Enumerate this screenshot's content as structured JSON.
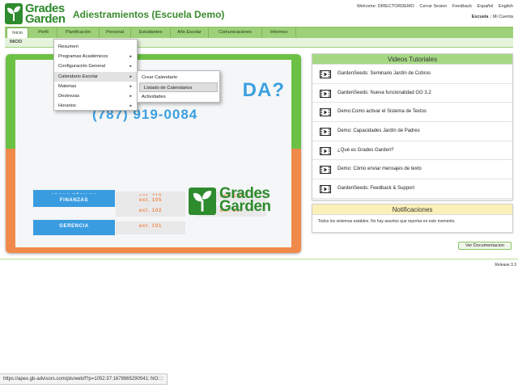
{
  "header": {
    "logo_line1": "Grades",
    "logo_line2": "Garden",
    "app_title": "Adiestramientos (Escuela Demo)",
    "top_links": {
      "welcome": "Welcome: DIRECTORDEMO",
      "logout": "Cerrar Sesion",
      "feedback": "Feedback",
      "spanish": "Español",
      "english": "English"
    },
    "user_links": {
      "school": "Escuela",
      "account": "Mi Cuenta",
      "separator": "|"
    }
  },
  "nav": {
    "tabs": [
      {
        "label": "Inicio"
      },
      {
        "label": "Perfil"
      },
      {
        "label": "Planificación"
      },
      {
        "label": "Personal"
      },
      {
        "label": "Estudiantes"
      },
      {
        "label": "Año Escolar"
      },
      {
        "label": "Comunicaciones"
      },
      {
        "label": "Informes"
      }
    ],
    "breadcrumb": "INICIO"
  },
  "menus": {
    "planificacion": [
      {
        "label": "Resumen",
        "arrow": ""
      },
      {
        "label": "Programas Académicos",
        "arrow": "▸"
      },
      {
        "label": "Configuración General",
        "arrow": "▸"
      },
      {
        "label": "Calendario Escolar",
        "arrow": "▸"
      },
      {
        "label": "Materias",
        "arrow": "▸"
      },
      {
        "label": "Destrezas",
        "arrow": "▸"
      },
      {
        "label": "Horarios",
        "arrow": "▸"
      }
    ],
    "calendario": [
      {
        "label": "Crear Calendario"
      },
      {
        "label": "Listado de Calendarios"
      },
      {
        "label": "Actividades"
      }
    ]
  },
  "banner": {
    "question_start": "¿",
    "question_end": "DA?",
    "phone": "(787) 919-0084",
    "departments": [
      {
        "label": "APOYO TÉCNICO",
        "exts": [
          "ext. 118",
          "ext. 110",
          "ext. 102",
          "ext. 107"
        ]
      },
      {
        "label": "VENTAS",
        "exts": [
          "ext. 106"
        ]
      },
      {
        "label": "FINANZAS",
        "exts": [
          "ext. 105"
        ]
      },
      {
        "label": "GERENCIA",
        "exts": [
          "ext. 101"
        ]
      }
    ],
    "logo_line1": "Grades",
    "logo_line2": "Garden"
  },
  "videos": {
    "title": "Videos Tutoriales",
    "items": [
      {
        "label": "GardenSeeds: Seminario Jardín de Cobros"
      },
      {
        "label": "GardenSeeds: Nueva funcionalidad GG 3.2"
      },
      {
        "label": "Demo:Como activar el Sistema de Textos"
      },
      {
        "label": "Demo: Capacidades Jardín de Padres"
      },
      {
        "label": "¿Qué es Grades Garden?"
      },
      {
        "label": "Demo: Cómo enviar mensajes de texto"
      },
      {
        "label": "GardenSeeds: Feedback & Support"
      }
    ]
  },
  "notifications": {
    "title": "Notificaciones",
    "text": "Todos los sistemas estables. No hay asuntos que reportar en este momento."
  },
  "doc_button": "Ver Documentacion",
  "release": "Release 3.3",
  "status_url": "https://apex.gb-advisors.com/pls/web/f?p=1052:37:1678965290541::NO::::",
  "colors": {
    "brand_green": "#2e8b2e",
    "nav_green": "#9ed07a",
    "banner_green": "#6cc144",
    "banner_orange": "#f08a4b",
    "banner_blue": "#3a9ce0"
  }
}
